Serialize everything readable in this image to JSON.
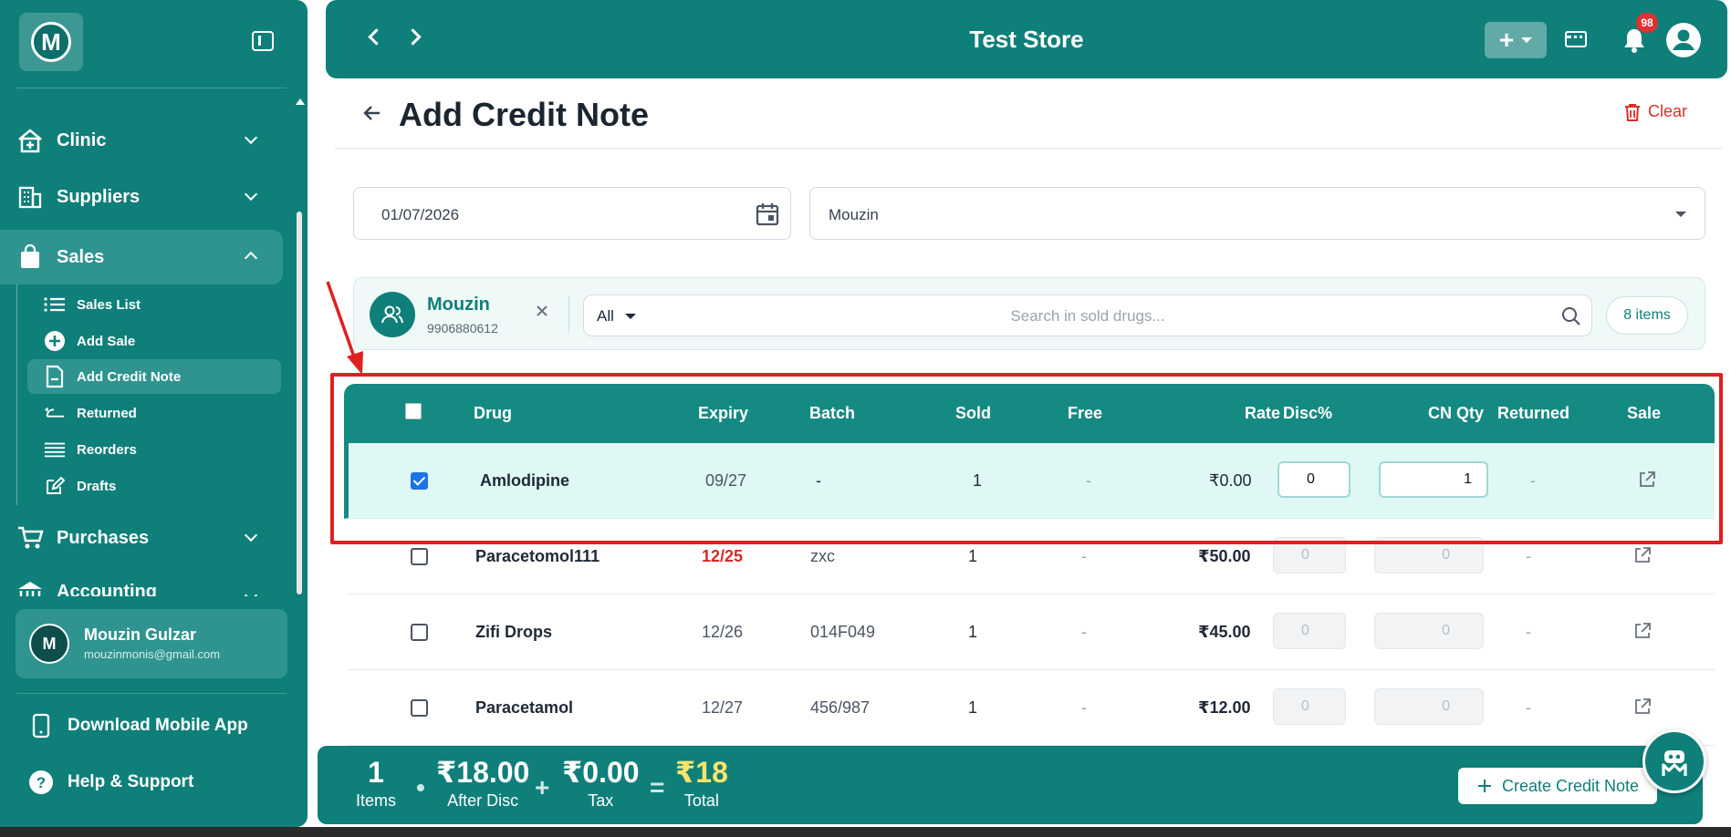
{
  "sidebar": {
    "logo_letter": "M",
    "nav": [
      {
        "label": "Clinic",
        "icon": "clinic-icon"
      },
      {
        "label": "Suppliers",
        "icon": "building-icon"
      },
      {
        "label": "Sales",
        "icon": "shopping-bag-icon"
      },
      {
        "label": "Purchases",
        "icon": "cart-icon"
      },
      {
        "label": "Accounting",
        "icon": "bank-icon"
      }
    ],
    "sales_sub": [
      {
        "label": "Sales List",
        "icon": "list-icon"
      },
      {
        "label": "Add Sale",
        "icon": "plus-circle-icon"
      },
      {
        "label": "Add Credit Note",
        "icon": "document-icon"
      },
      {
        "label": "Returned",
        "icon": "return-arrow-icon"
      },
      {
        "label": "Reorders",
        "icon": "menu-lines-icon"
      },
      {
        "label": "Drafts",
        "icon": "edit-icon"
      }
    ],
    "user": {
      "initial": "M",
      "name": "Mouzin Gulzar",
      "email": "mouzinmonis@gmail.com"
    },
    "download_app": "Download Mobile App",
    "help": "Help & Support"
  },
  "topbar": {
    "store_name": "Test Store",
    "notification_count": "98"
  },
  "page": {
    "title": "Add Credit Note",
    "clear_label": "Clear"
  },
  "form": {
    "date": "01/07/2026",
    "customer": "Mouzin"
  },
  "customer_strip": {
    "name": "Mouzin",
    "phone": "9906880612",
    "filter": "All",
    "search_placeholder": "Search in sold drugs...",
    "items_count": "8 items"
  },
  "table": {
    "columns": [
      "Drug",
      "Expiry",
      "Batch",
      "Sold",
      "Free",
      "Rate",
      "Disc%",
      "CN Qty",
      "Returned",
      "Sale"
    ],
    "rows": [
      {
        "drug": "Amlodipine",
        "expiry": "09/27",
        "batch": "-",
        "sold": "1",
        "free": "-",
        "rate": "₹0.00",
        "disc": "0",
        "cn_qty": "1",
        "returned": "-",
        "checked": true
      },
      {
        "drug": "Paracetomol111",
        "expiry": "12/25",
        "batch": "zxc",
        "sold": "1",
        "free": "-",
        "rate": "₹50.00",
        "disc": "0",
        "cn_qty": "0",
        "returned": "-",
        "checked": false,
        "expired": true
      },
      {
        "drug": "Zifi Drops",
        "expiry": "12/26",
        "batch": "014F049",
        "sold": "1",
        "free": "-",
        "rate": "₹45.00",
        "disc": "0",
        "cn_qty": "0",
        "returned": "-",
        "checked": false
      },
      {
        "drug": "Paracetamol",
        "expiry": "12/27",
        "batch": "456/987",
        "sold": "1",
        "free": "-",
        "rate": "₹12.00",
        "disc": "0",
        "cn_qty": "0",
        "returned": "-",
        "checked": false
      }
    ]
  },
  "summary": {
    "items_value": "1",
    "items_label": "Items",
    "after_disc_value": "₹18.00",
    "after_disc_label": "After Disc",
    "tax_value": "₹0.00",
    "tax_label": "Tax",
    "total_value": "₹18",
    "total_label": "Total",
    "create_label": "Create Credit Note"
  },
  "colors": {
    "brand": "#0f7f7a",
    "highlight": "#e02020",
    "expired": "#d62828"
  }
}
